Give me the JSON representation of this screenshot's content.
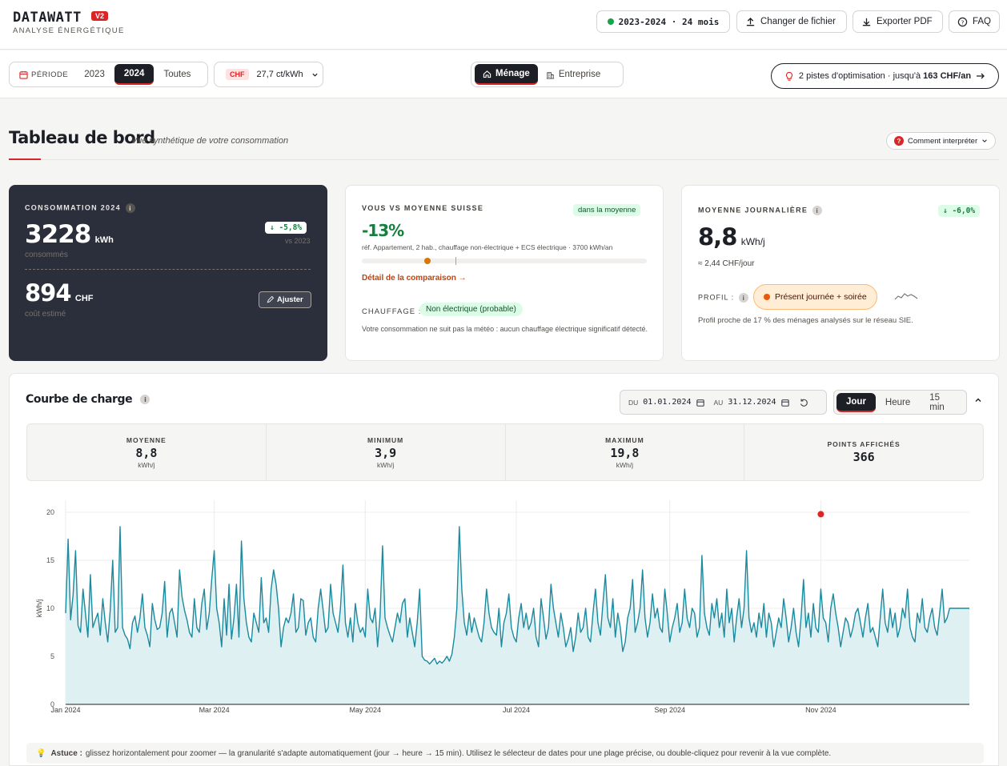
{
  "header": {
    "logo": "DATAWATT",
    "badge": "V2",
    "subtitle": "ANALYSE ÉNERGÉTIQUE",
    "dataset": "2023-2024 · 24 mois",
    "change_file": "Changer de fichier",
    "export_pdf": "Exporter PDF",
    "faq": "FAQ"
  },
  "filters": {
    "period_label": "PÉRIODE",
    "years": [
      "2023",
      "2024",
      "Toutes"
    ],
    "selected_year": "2024",
    "currency": "CHF",
    "tariff": "27,7 ct/kWh",
    "profile_menage": "Ménage",
    "profile_entreprise": "Entreprise",
    "optimization_text": "2 pistes d'optimisation · jusqu'à ",
    "optimization_amount": "163 CHF/an"
  },
  "page": {
    "title": "Tableau de bord",
    "subtitle": "Vue synthétique de votre consommation",
    "help": "Comment interpréter"
  },
  "card_consumption": {
    "label": "CONSOMMATION 2024",
    "value": "3228",
    "unit": "kWh",
    "caption": "consommés",
    "delta": "↓ -5,8%",
    "delta_ref": "vs 2023",
    "cost": "894",
    "cost_unit": "CHF",
    "cost_caption": "coût estimé",
    "adjust": "Ajuster"
  },
  "card_compare": {
    "label": "VOUS VS MOYENNE SUISSE",
    "badge": "dans la moyenne",
    "value": "-13%",
    "ref": "réf. Appartement, 2 hab., chauffage non-électrique + ECS électrique · 3700 kWh/an",
    "position": 0.23,
    "link": "Détail de la comparaison →",
    "heating_label": "CHAUFFAGE :",
    "heating_value": "Non électrique (probable)",
    "heating_note": "Votre consommation ne suit pas la météo : aucun chauffage électrique significatif détecté."
  },
  "card_daily": {
    "label": "MOYENNE JOURNALIÈRE",
    "delta": "↓ -6,0%",
    "value": "8,8",
    "unit": "kWh/j",
    "cost": "≈ 2,44 CHF/jour",
    "profile_label": "PROFIL :",
    "profile_value": "Présent journée + soirée",
    "profile_note": "Profil proche de 17 % des ménages analysés sur le réseau SIE."
  },
  "load_curve": {
    "title": "Courbe de charge",
    "from_label": "DU",
    "from": "01.01.2024",
    "to_label": "AU",
    "to": "31.12.2024",
    "granularity": [
      "Jour",
      "Heure",
      "15 min"
    ],
    "selected_granularity": "Jour",
    "stats": [
      {
        "label": "MOYENNE",
        "value": "8,8",
        "unit": "kWh/j"
      },
      {
        "label": "MINIMUM",
        "value": "3,9",
        "unit": "kWh/j"
      },
      {
        "label": "MAXIMUM",
        "value": "19,8",
        "unit": "kWh/j"
      },
      {
        "label": "POINTS AFFICHÉS",
        "value": "366",
        "unit": ""
      }
    ],
    "tip_label": "Astuce :",
    "tip": "glissez horizontalement pour zoomer — la granularité s'adapte automatiquement (jour → heure → 15 min). Utilisez le sélecteur de dates pour une plage précise, ou double-cliquez pour revenir à la vue complète."
  },
  "chart_data": {
    "type": "area",
    "ylabel": "kWh/j",
    "ylim": [
      0,
      20
    ],
    "yticks": [
      0,
      5,
      10,
      15,
      20
    ],
    "xticks": [
      "Jan 2024",
      "Mar 2024",
      "May 2024",
      "Jul 2024",
      "Sep 2024",
      "Nov 2024"
    ],
    "xtick_days": [
      0,
      60,
      121,
      182,
      244,
      305
    ],
    "x_days": 366,
    "grid": true,
    "line_color": "#1a8a9e",
    "fill_color": "#dff0f3",
    "peak": {
      "day": 305,
      "value": 19.8,
      "color": "#dc2626"
    },
    "series": [
      {
        "values": [
          9.5,
          17.2,
          8.8,
          11.4,
          16.0,
          8.2,
          7.5,
          12.0,
          9.5,
          7.0,
          13.5,
          8.0,
          8.8,
          9.5,
          7.2,
          11.0,
          8.5,
          6.5,
          9.8,
          15.0,
          7.5,
          8.0,
          18.5,
          8.0,
          7.2,
          6.8,
          5.8,
          8.5,
          9.2,
          7.5,
          9.0,
          11.5,
          8.0,
          7.2,
          6.0,
          10.5,
          8.8,
          7.8,
          8.0,
          9.5,
          12.8,
          7.0,
          9.5,
          10.0,
          8.5,
          7.0,
          14.0,
          11.2,
          9.8,
          8.8,
          7.5,
          7.0,
          11.0,
          8.0,
          7.5,
          10.5,
          12.0,
          7.8,
          9.5,
          13.0,
          16.0,
          10.0,
          8.5,
          6.0,
          11.0,
          7.2,
          12.5,
          6.8,
          9.0,
          12.5,
          7.0,
          17.0,
          11.0,
          8.5,
          7.0,
          6.5,
          9.5,
          8.5,
          7.5,
          13.2,
          8.5,
          9.0,
          7.5,
          12.0,
          14.0,
          12.5,
          10.0,
          6.0,
          8.0,
          9.0,
          8.5,
          9.5,
          11.5,
          7.5,
          8.0,
          11.0,
          10.8,
          7.2,
          8.5,
          9.0,
          7.0,
          6.5,
          10.0,
          12.0,
          9.8,
          7.5,
          8.0,
          12.5,
          9.5,
          8.5,
          7.5,
          10.0,
          14.5,
          8.5,
          7.0,
          9.0,
          6.5,
          10.5,
          8.5,
          7.5,
          8.0,
          7.0,
          12.0,
          9.0,
          8.5,
          10.0,
          6.0,
          9.2,
          16.5,
          9.0,
          8.0,
          7.2,
          6.5,
          8.0,
          9.5,
          8.5,
          10.5,
          11.0,
          7.0,
          9.0,
          7.5,
          6.0,
          8.5,
          12.0,
          5.0,
          4.6,
          4.5,
          4.2,
          4.5,
          4.8,
          4.2,
          4.5,
          4.3,
          4.6,
          5.0,
          4.5,
          5.2,
          7.0,
          10.0,
          18.5,
          12.0,
          8.5,
          7.2,
          9.5,
          7.5,
          9.0,
          8.0,
          7.0,
          6.5,
          8.5,
          12.0,
          9.5,
          8.0,
          7.5,
          7.2,
          10.0,
          6.0,
          8.5,
          9.5,
          11.5,
          8.0,
          7.0,
          6.5,
          9.0,
          10.5,
          8.0,
          9.5,
          7.8,
          8.5,
          10.0,
          7.0,
          6.0,
          11.0,
          9.0,
          6.8,
          8.0,
          12.5,
          10.0,
          8.5,
          7.0,
          9.5,
          8.0,
          6.0,
          6.8,
          8.0,
          5.5,
          7.0,
          9.5,
          7.5,
          8.0,
          10.0,
          7.0,
          6.5,
          9.5,
          12.0,
          8.5,
          7.2,
          10.5,
          13.5,
          9.0,
          8.0,
          11.0,
          7.0,
          9.5,
          8.0,
          5.5,
          6.5,
          9.0,
          10.0,
          13.0,
          7.5,
          8.5,
          10.0,
          14.0,
          9.0,
          7.0,
          8.5,
          11.5,
          9.0,
          10.0,
          8.0,
          7.5,
          12.0,
          9.5,
          6.5,
          8.0,
          9.0,
          10.5,
          7.5,
          8.5,
          12.0,
          9.0,
          8.0,
          10.0,
          9.5,
          7.0,
          8.0,
          15.5,
          9.5,
          8.0,
          7.2,
          10.5,
          9.0,
          11.0,
          8.0,
          9.5,
          7.0,
          12.0,
          8.5,
          10.0,
          6.5,
          9.0,
          11.0,
          8.0,
          10.0,
          16.0,
          9.0,
          7.5,
          8.5,
          7.0,
          9.5,
          8.0,
          10.5,
          7.0,
          9.5,
          8.5,
          6.0,
          7.5,
          9.0,
          8.0,
          11.0,
          9.0,
          6.5,
          8.0,
          10.0,
          7.5,
          6.0,
          9.0,
          13.0,
          8.0,
          9.5,
          7.0,
          10.5,
          8.0,
          7.5,
          12.0,
          9.0,
          8.5,
          6.5,
          10.0,
          11.5,
          9.5,
          8.0,
          6.0,
          7.5,
          9.0,
          8.5,
          7.0,
          8.0,
          9.5,
          10.0,
          8.5,
          7.0,
          9.0,
          10.5,
          7.5,
          8.0,
          7.0,
          6.0,
          9.0,
          12.0,
          8.5,
          7.5,
          10.0,
          8.0,
          9.5,
          7.0,
          8.0,
          10.0,
          9.0,
          12.0,
          8.0,
          7.0,
          6.5,
          9.5,
          8.5,
          11.0,
          8.0,
          7.5,
          9.0,
          10.0,
          8.0,
          7.2,
          9.5,
          12.0,
          8.5,
          9.0,
          10.0
        ],
        "note": ""
      }
    ]
  }
}
